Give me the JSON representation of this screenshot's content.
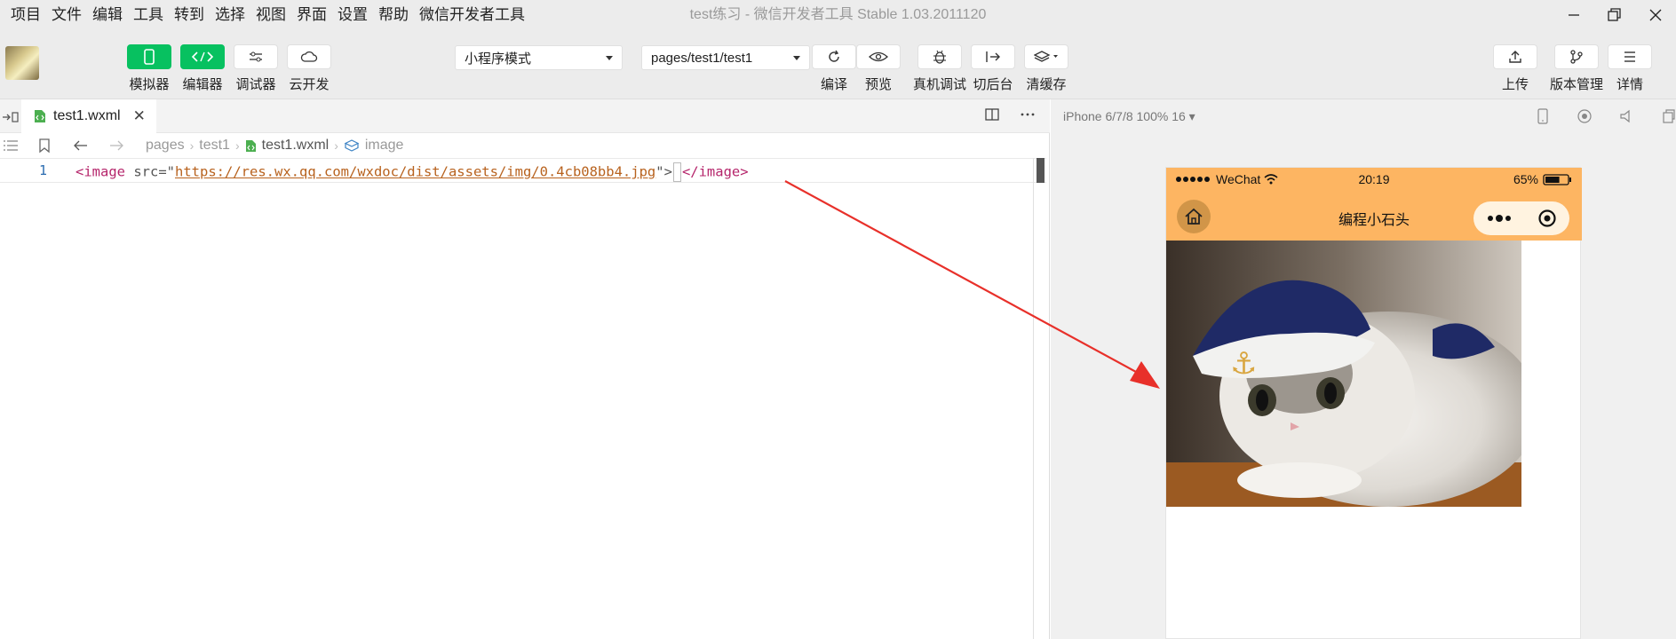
{
  "menu": [
    "项目",
    "文件",
    "编辑",
    "工具",
    "转到",
    "选择",
    "视图",
    "界面",
    "设置",
    "帮助",
    "微信开发者工具"
  ],
  "window_title": "test练习 - 微信开发者工具 Stable 1.03.2011120",
  "toolbar": {
    "simulator": "模拟器",
    "editor": "编辑器",
    "debugger": "调试器",
    "cloud": "云开发",
    "mode_select": "小程序模式",
    "page_select": "pages/test1/test1",
    "compile": "编译",
    "preview": "预览",
    "real_debug": "真机调试",
    "background": "切后台",
    "clear_cache": "清缓存",
    "upload": "上传",
    "version": "版本管理",
    "details": "详情"
  },
  "editor": {
    "tab_name": "test1.wxml",
    "breadcrumb": [
      "pages",
      "test1",
      "test1.wxml",
      "image"
    ],
    "line_number": "1",
    "code": {
      "open_tag": "<image",
      "attr": " src=",
      "quote_open": "\"",
      "url": "https://res.wx.qq.com/wxdoc/dist/assets/img/0.4cb08bb4.jpg",
      "quote_close": "\">",
      "close_tag": "</image>"
    }
  },
  "simulator": {
    "device": "iPhone 6/7/8 100% 16 ▾",
    "carrier": "WeChat",
    "time": "20:19",
    "battery": "65%",
    "battery_level": 0.65,
    "nav_title": "编程小石头"
  },
  "colors": {
    "accent_green": "#07c160",
    "nav_orange": "#fdb562",
    "arrow_red": "#e8302a"
  }
}
